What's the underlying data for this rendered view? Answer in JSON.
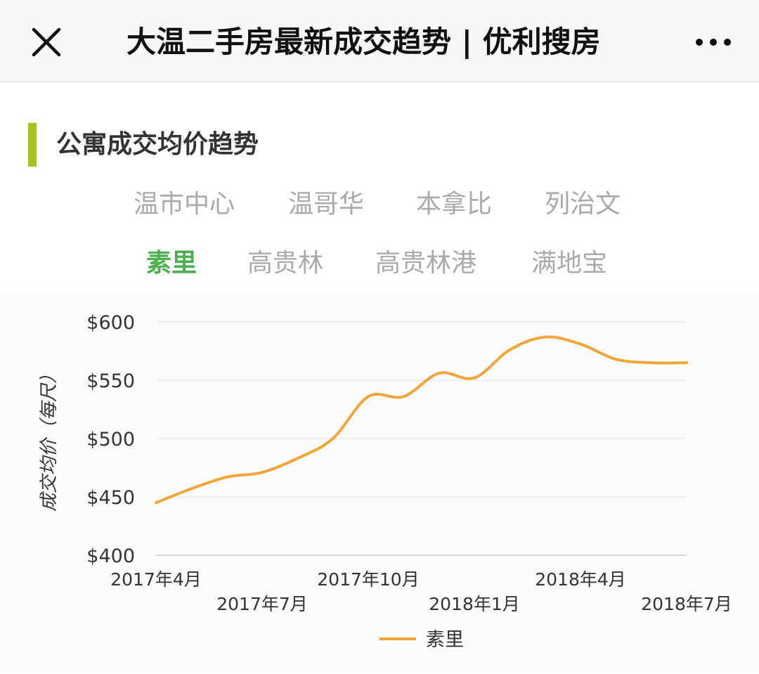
{
  "header": {
    "close_icon": "close-icon",
    "title": "大温二手房最新成交趋势 | 优利搜房",
    "more_icon": "more-dots-icon"
  },
  "section": {
    "title": "公寓成交均价趋势",
    "accent_color": "#a9c41f"
  },
  "region_tabs": {
    "row1": [
      "温市中心",
      "温哥华",
      "本拿比",
      "列治文"
    ],
    "row2": [
      "素里",
      "高贵林",
      "高贵林港",
      "满地宝"
    ],
    "active": "素里",
    "active_color": "#4caf50"
  },
  "chart_data": {
    "type": "line",
    "x": [
      "2017年4月",
      "2017年5月",
      "2017年6月",
      "2017年7月",
      "2017年8月",
      "2017年9月",
      "2017年10月",
      "2017年11月",
      "2017年12月",
      "2018年1月",
      "2018年2月",
      "2018年3月",
      "2018年4月",
      "2018年5月",
      "2018年6月",
      "2018年7月"
    ],
    "x_tick_labels": [
      "2017年4月",
      "2017年7月",
      "2017年10月",
      "2018年1月",
      "2018年4月",
      "2018年7月"
    ],
    "series": [
      {
        "name": "素里",
        "color": "#f0a63a",
        "values": [
          445,
          457,
          467,
          471,
          483,
          500,
          536,
          536,
          556,
          552,
          576,
          587,
          581,
          568,
          565,
          565
        ]
      }
    ],
    "y_tick_labels": [
      "$400",
      "$450",
      "$500",
      "$550",
      "$600"
    ],
    "ylim": [
      400,
      600
    ],
    "ylabel": "成交均价（每尺）",
    "xlabel": "",
    "grid": true,
    "legend": "bottom"
  }
}
